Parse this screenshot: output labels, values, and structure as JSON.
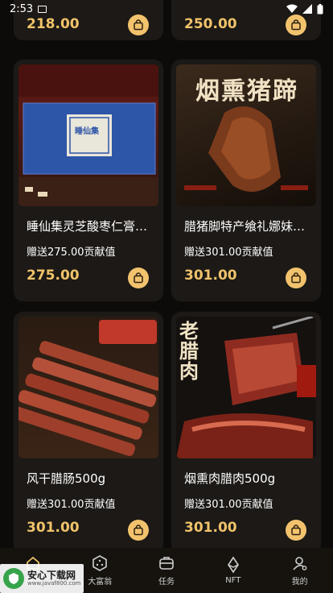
{
  "status_bar": {
    "time": "2:53"
  },
  "top_row": {
    "prices": [
      "218.00",
      "250.00"
    ]
  },
  "products": [
    {
      "title": "睡仙集灵芝酸枣仁膏…",
      "reward": "赠送275.00贡献值",
      "price": "275.00",
      "image_text": "睡仙集"
    },
    {
      "title": "腊猪脚特产飨礼娜妹…",
      "reward": "赠送301.00贡献值",
      "price": "301.00",
      "image_text": "烟熏猪蹄"
    },
    {
      "title": "风干腊肠500g",
      "reward": "赠送301.00贡献值",
      "price": "301.00",
      "image_text": ""
    },
    {
      "title": "烟熏肉腊肉500g",
      "reward": "赠送301.00贡献值",
      "price": "301.00",
      "image_text": "老腊肉"
    }
  ],
  "tabbar": {
    "items": [
      {
        "label": "首页",
        "icon": "home-icon"
      },
      {
        "label": "大富翁",
        "icon": "dice-icon"
      },
      {
        "label": "任务",
        "icon": "task-icon"
      },
      {
        "label": "NFT",
        "icon": "nft-icon"
      },
      {
        "label": "我的",
        "icon": "profile-icon"
      }
    ]
  },
  "watermark": {
    "main": "安心下载网",
    "sub": "www.javaf800.com"
  },
  "colors": {
    "accent": "#f0c36a",
    "cart": "#f2c26d",
    "card": "#1c1916",
    "background": "#0d0b09"
  }
}
